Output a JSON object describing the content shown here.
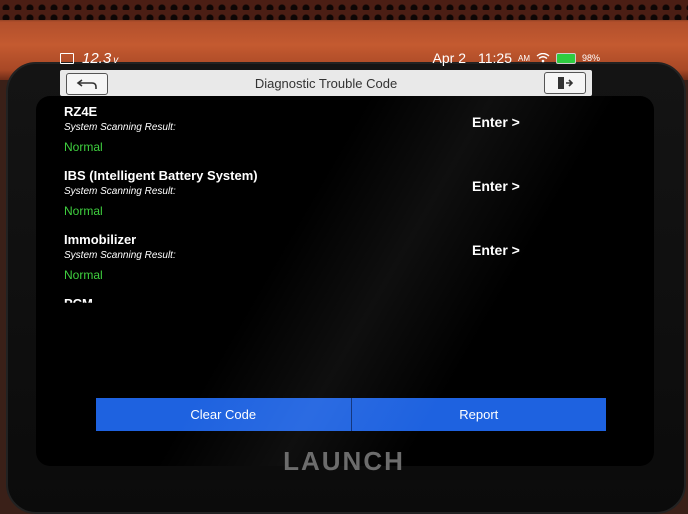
{
  "device": {
    "brand": "LAUNCH"
  },
  "status_bar": {
    "voltage": "12.3",
    "voltage_unit": "v",
    "date": "Apr 2",
    "time": "11:25",
    "ampm": "AM",
    "battery_percent": "98%"
  },
  "title_bar": {
    "title": "Diagnostic Trouble Code"
  },
  "systems": [
    {
      "name": "RZ4E",
      "scan_label": "System Scanning Result:",
      "result": "Normal",
      "action": "Enter >"
    },
    {
      "name": "IBS (Intelligent Battery System)",
      "scan_label": "System Scanning Result:",
      "result": "Normal",
      "action": "Enter >"
    },
    {
      "name": "Immobilizer",
      "scan_label": "System Scanning Result:",
      "result": "Normal",
      "action": "Enter >"
    }
  ],
  "partial_system": "PCM",
  "bottom_bar": {
    "clear_label": "Clear Code",
    "report_label": "Report"
  },
  "colors": {
    "accent_blue": "#1e62e0",
    "normal_green": "#3fd03f",
    "title_bg": "#e9e9e9"
  }
}
